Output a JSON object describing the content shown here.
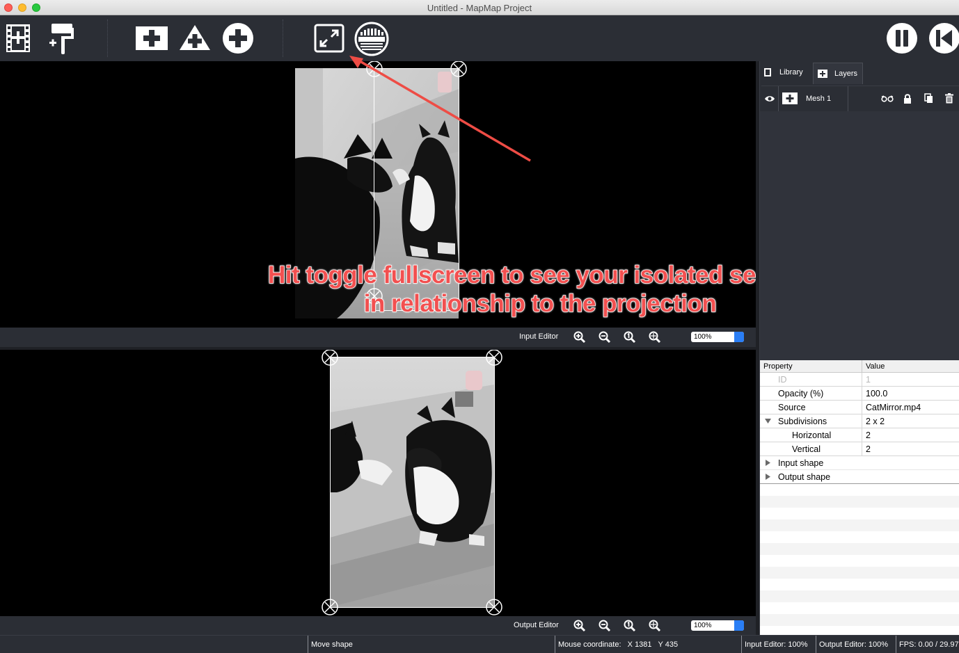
{
  "window": {
    "title": "Untitled - MapMap Project"
  },
  "toolbar": {
    "buttons": [
      {
        "name": "add-media-button",
        "icon": "film-plus-icon"
      },
      {
        "name": "add-color-button",
        "icon": "paint-roller-plus-icon"
      },
      {
        "name": "add-mesh-button",
        "icon": "square-plus-icon"
      },
      {
        "name": "add-triangle-button",
        "icon": "triangle-plus-icon"
      },
      {
        "name": "add-ellipse-button",
        "icon": "circle-plus-icon"
      },
      {
        "name": "toggle-fullscreen-button",
        "icon": "fullscreen-icon"
      },
      {
        "name": "display-test-signal-button",
        "icon": "test-pattern-icon"
      },
      {
        "name": "pause-button",
        "icon": "pause-icon"
      },
      {
        "name": "rewind-button",
        "icon": "skip-back-icon"
      }
    ]
  },
  "input_editor": {
    "label": "Input Editor",
    "zoom": "100%"
  },
  "output_editor": {
    "label": "Output Editor",
    "zoom": "100%"
  },
  "annotation": {
    "line1": "Hit toggle fullscreen to see your isolated section",
    "line2": "in relationship to the projection",
    "color": "#f25050"
  },
  "tabs": [
    {
      "label": "Library",
      "icon": "library-icon"
    },
    {
      "label": "Layers",
      "icon": "plus-icon"
    }
  ],
  "layers": [
    {
      "name": "Mesh 1",
      "visible": true
    }
  ],
  "properties": {
    "headers": {
      "property": "Property",
      "value": "Value"
    },
    "rows": [
      {
        "name": "ID",
        "value": "1",
        "disabled": true
      },
      {
        "name": "Opacity (%)",
        "value": "100.0"
      },
      {
        "name": "Source",
        "value": "CatMirror.mp4"
      },
      {
        "name": "Subdivisions",
        "value": "2 x 2",
        "expanded": true
      },
      {
        "name": "Horizontal",
        "value": "2",
        "child": true
      },
      {
        "name": "Vertical",
        "value": "2",
        "child": true
      },
      {
        "name": "Input shape",
        "value": "",
        "collapsed": true
      },
      {
        "name": "Output shape",
        "value": "",
        "collapsed": true
      }
    ]
  },
  "status": {
    "action": "Move shape",
    "mouse_label": "Mouse coordinate:",
    "mouse_x": "X 1381",
    "mouse_y": "Y 435",
    "input_zoom": "Input Editor: 100%",
    "output_zoom": "Output Editor: 100%",
    "fps": "FPS: 0.00 / 29.97"
  },
  "colors": {
    "background": "#2b2e35",
    "accent": "#2a7ef5",
    "annotation": "#f25050"
  }
}
